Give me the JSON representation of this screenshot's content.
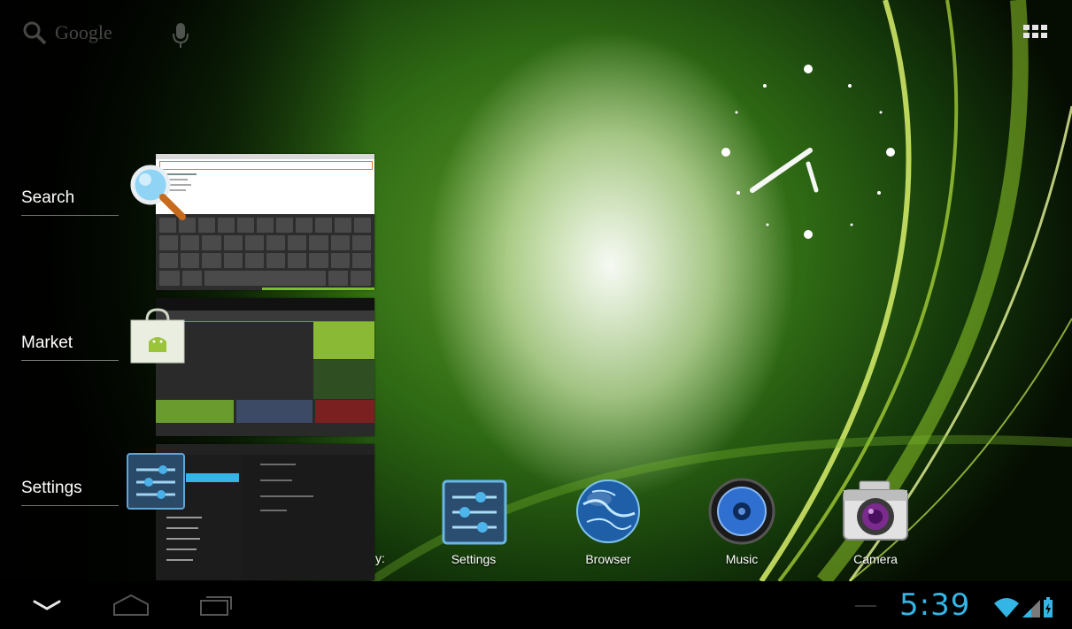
{
  "top_bar": {
    "search_label": "Google",
    "icons": [
      "search-icon",
      "mic-icon",
      "apps-grid-icon"
    ]
  },
  "recent_apps": [
    {
      "label": "Search",
      "icon": "search-magnifier-icon"
    },
    {
      "label": "Market",
      "icon": "market-bag-icon"
    },
    {
      "label": "Settings",
      "icon": "settings-sliders-icon"
    }
  ],
  "dock": [
    {
      "label": "Settings",
      "icon": "settings-icon"
    },
    {
      "label": "Browser",
      "icon": "globe-icon"
    },
    {
      "label": "Music",
      "icon": "speaker-icon"
    },
    {
      "label": "Camera",
      "icon": "camera-icon"
    }
  ],
  "dock_partial_label": "y:",
  "navbar": {
    "buttons": [
      "back-icon",
      "home-icon",
      "recent-apps-icon"
    ],
    "time": "5:39",
    "status_icons": [
      "wifi-icon",
      "signal-icon",
      "battery-charging-icon"
    ]
  },
  "colors": {
    "accent": "#33b5e5",
    "wallpaper_green": "#4a8a1e"
  }
}
